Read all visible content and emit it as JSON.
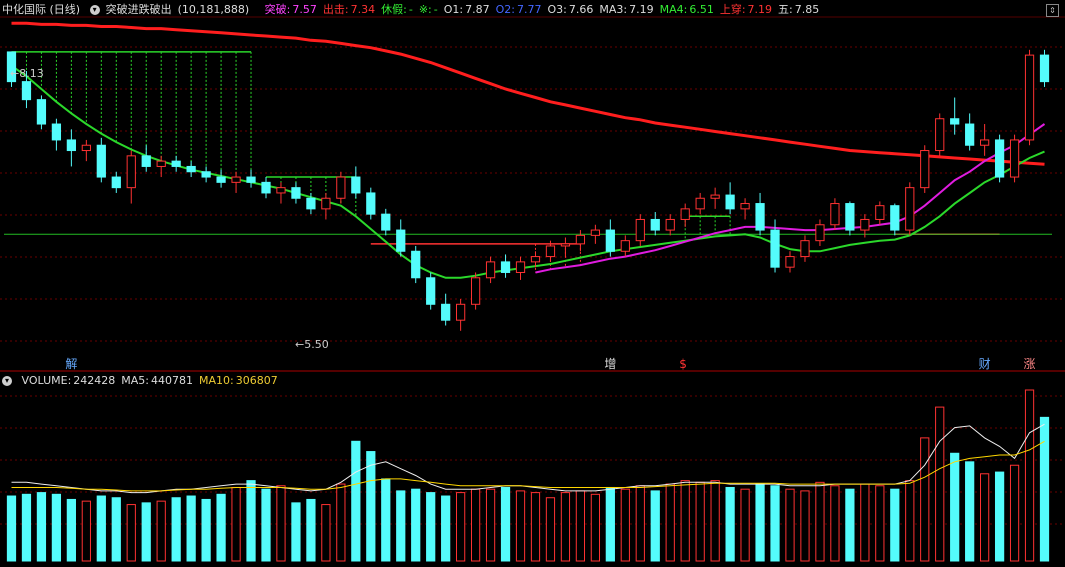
{
  "price_header": {
    "stock": "中化国际 (日线)",
    "indicator_name": "突破进跌破出",
    "params": "(10,181,888)",
    "items": [
      {
        "label": "突破:",
        "value": "7.57",
        "color": "#ff44ff"
      },
      {
        "label": "出击:",
        "value": "7.34",
        "color": "#ff3333"
      },
      {
        "label": "休假:",
        "value": "-",
        "color": "#33ee33"
      },
      {
        "label": "※:",
        "value": "-",
        "color": "#33ee33"
      },
      {
        "label": "O1:",
        "value": "7.87",
        "color": "#dddddd"
      },
      {
        "label": "O2:",
        "value": "7.77",
        "color": "#4466ff"
      },
      {
        "label": "O3:",
        "value": "7.66",
        "color": "#dddddd"
      },
      {
        "label": "MA3:",
        "value": "7.19",
        "color": "#dddddd"
      },
      {
        "label": "MA4:",
        "value": "6.51",
        "color": "#33ee33"
      },
      {
        "label": "上穿:",
        "value": "7.19",
        "color": "#ff3333"
      },
      {
        "label": "五:",
        "value": "7.85",
        "color": "#dddddd"
      }
    ]
  },
  "volume_header": {
    "items": [
      {
        "label": "VOLUME:",
        "value": "242428",
        "color": "#dddddd"
      },
      {
        "label": "MA5:",
        "value": "440781",
        "color": "#dddddd"
      },
      {
        "label": "MA10:",
        "value": "306807",
        "color": "#eecc33"
      }
    ]
  },
  "markers": [
    {
      "text": "解",
      "color": "#66aaff"
    },
    {
      "text": "增",
      "color": "#dddddd"
    },
    {
      "text": "$",
      "color": "#ff3333"
    },
    {
      "text": "财",
      "color": "#66aaff"
    },
    {
      "text": "涨",
      "color": "#ff8888"
    }
  ],
  "annotations": {
    "high": "8.13",
    "low": "5.50"
  },
  "icons": {
    "collapse": "circle-down-icon",
    "scroll": "up-down-icon"
  },
  "colors": {
    "up": "#ff3232",
    "down": "#54fcfc",
    "ma_red": "#ff1e1e",
    "ma_green": "#2bd82b",
    "ma_magenta": "#e01ce0",
    "ma10": "#ffd700"
  },
  "chart_data": [
    {
      "type": "candlestick",
      "ylim": [
        5.3,
        8.45
      ],
      "x_count": 70,
      "ohlc": [
        [
          8.13,
          8.13,
          7.8,
          7.85
        ],
        [
          7.85,
          7.95,
          7.6,
          7.68
        ],
        [
          7.68,
          7.72,
          7.4,
          7.45
        ],
        [
          7.45,
          7.5,
          7.2,
          7.3
        ],
        [
          7.3,
          7.4,
          7.05,
          7.2
        ],
        [
          7.2,
          7.3,
          7.1,
          7.25
        ],
        [
          7.25,
          7.32,
          6.9,
          6.95
        ],
        [
          6.95,
          7.0,
          6.8,
          6.85
        ],
        [
          6.85,
          7.2,
          6.7,
          7.15
        ],
        [
          7.15,
          7.25,
          7.0,
          7.05
        ],
        [
          7.05,
          7.15,
          6.95,
          7.1
        ],
        [
          7.1,
          7.15,
          7.0,
          7.05
        ],
        [
          7.05,
          7.1,
          6.95,
          7.0
        ],
        [
          7.0,
          7.05,
          6.9,
          6.95
        ],
        [
          6.95,
          7.02,
          6.85,
          6.9
        ],
        [
          6.9,
          7.0,
          6.8,
          6.95
        ],
        [
          6.95,
          7.02,
          6.85,
          6.9
        ],
        [
          6.9,
          6.95,
          6.75,
          6.8
        ],
        [
          6.8,
          6.9,
          6.7,
          6.85
        ],
        [
          6.85,
          6.9,
          6.7,
          6.75
        ],
        [
          6.75,
          6.8,
          6.6,
          6.65
        ],
        [
          6.65,
          6.8,
          6.55,
          6.75
        ],
        [
          6.75,
          7.0,
          6.7,
          6.95
        ],
        [
          6.95,
          7.05,
          6.75,
          6.8
        ],
        [
          6.8,
          6.85,
          6.55,
          6.6
        ],
        [
          6.6,
          6.65,
          6.4,
          6.45
        ],
        [
          6.45,
          6.55,
          6.2,
          6.25
        ],
        [
          6.25,
          6.3,
          5.95,
          6.0
        ],
        [
          6.0,
          6.05,
          5.7,
          5.75
        ],
        [
          5.75,
          5.85,
          5.55,
          5.6
        ],
        [
          5.6,
          5.8,
          5.5,
          5.75
        ],
        [
          5.75,
          6.05,
          5.7,
          6.0
        ],
        [
          6.0,
          6.2,
          5.95,
          6.15
        ],
        [
          6.15,
          6.22,
          6.0,
          6.05
        ],
        [
          6.05,
          6.2,
          5.98,
          6.15
        ],
        [
          6.15,
          6.25,
          6.1,
          6.2
        ],
        [
          6.2,
          6.35,
          6.15,
          6.3
        ],
        [
          6.3,
          6.38,
          6.2,
          6.32
        ],
        [
          6.32,
          6.45,
          6.25,
          6.4
        ],
        [
          6.4,
          6.5,
          6.32,
          6.45
        ],
        [
          6.45,
          6.55,
          6.2,
          6.25
        ],
        [
          6.25,
          6.4,
          6.2,
          6.35
        ],
        [
          6.35,
          6.6,
          6.3,
          6.55
        ],
        [
          6.55,
          6.62,
          6.4,
          6.45
        ],
        [
          6.45,
          6.6,
          6.4,
          6.55
        ],
        [
          6.55,
          6.7,
          6.48,
          6.65
        ],
        [
          6.65,
          6.8,
          6.6,
          6.75
        ],
        [
          6.75,
          6.85,
          6.65,
          6.78
        ],
        [
          6.78,
          6.9,
          6.6,
          6.65
        ],
        [
          6.65,
          6.75,
          6.55,
          6.7
        ],
        [
          6.7,
          6.8,
          6.4,
          6.45
        ],
        [
          6.45,
          6.55,
          6.05,
          6.1
        ],
        [
          6.1,
          6.25,
          6.05,
          6.2
        ],
        [
          6.2,
          6.4,
          6.15,
          6.35
        ],
        [
          6.35,
          6.55,
          6.3,
          6.5
        ],
        [
          6.5,
          6.75,
          6.45,
          6.7
        ],
        [
          6.7,
          6.72,
          6.4,
          6.45
        ],
        [
          6.45,
          6.6,
          6.38,
          6.55
        ],
        [
          6.55,
          6.72,
          6.5,
          6.68
        ],
        [
          6.68,
          6.7,
          6.4,
          6.45
        ],
        [
          6.45,
          6.9,
          6.4,
          6.85
        ],
        [
          6.85,
          7.25,
          6.8,
          7.2
        ],
        [
          7.2,
          7.55,
          7.15,
          7.5
        ],
        [
          7.5,
          7.7,
          7.35,
          7.45
        ],
        [
          7.45,
          7.55,
          7.2,
          7.25
        ],
        [
          7.25,
          7.45,
          7.15,
          7.3
        ],
        [
          7.3,
          7.35,
          6.9,
          6.95
        ],
        [
          6.95,
          7.35,
          6.9,
          7.3
        ],
        [
          7.3,
          8.15,
          7.25,
          8.1
        ],
        [
          8.1,
          8.15,
          7.8,
          7.85
        ]
      ],
      "ma_red": [
        8.4,
        8.4,
        8.39,
        8.39,
        8.38,
        8.38,
        8.37,
        8.37,
        8.36,
        8.35,
        8.35,
        8.34,
        8.33,
        8.32,
        8.31,
        8.3,
        8.29,
        8.28,
        8.27,
        8.26,
        8.24,
        8.23,
        8.21,
        8.19,
        8.17,
        8.14,
        8.11,
        8.07,
        8.03,
        7.98,
        7.93,
        7.88,
        7.83,
        7.78,
        7.74,
        7.7,
        7.66,
        7.63,
        7.6,
        7.57,
        7.54,
        7.51,
        7.49,
        7.46,
        7.44,
        7.42,
        7.4,
        7.38,
        7.36,
        7.34,
        7.32,
        7.3,
        7.28,
        7.26,
        7.24,
        7.22,
        7.2,
        7.19,
        7.18,
        7.17,
        7.16,
        7.15,
        7.14,
        7.13,
        7.12,
        7.11,
        7.1,
        7.09,
        7.08,
        7.07
      ],
      "ma_green": [
        8.0,
        7.9,
        7.78,
        7.66,
        7.55,
        7.45,
        7.36,
        7.28,
        7.21,
        7.15,
        7.1,
        7.06,
        7.02,
        6.99,
        6.96,
        6.93,
        6.9,
        6.87,
        6.84,
        6.8,
        6.76,
        6.72,
        6.68,
        6.58,
        6.46,
        6.34,
        6.22,
        6.12,
        6.05,
        6.0,
        6.0,
        6.02,
        6.05,
        6.07,
        6.09,
        6.11,
        6.13,
        6.16,
        6.19,
        6.22,
        6.25,
        6.27,
        6.29,
        6.31,
        6.33,
        6.35,
        6.37,
        6.39,
        6.4,
        6.41,
        6.38,
        6.32,
        6.27,
        6.25,
        6.25,
        6.28,
        6.31,
        6.33,
        6.35,
        6.36,
        6.4,
        6.48,
        6.58,
        6.7,
        6.8,
        6.9,
        6.97,
        7.05,
        7.13,
        7.19
      ],
      "ma_magenta": [
        null,
        null,
        null,
        null,
        null,
        null,
        null,
        null,
        null,
        null,
        null,
        null,
        null,
        null,
        null,
        null,
        null,
        null,
        null,
        null,
        null,
        null,
        null,
        null,
        null,
        null,
        null,
        null,
        null,
        null,
        null,
        null,
        null,
        null,
        null,
        6.05,
        6.08,
        6.1,
        6.12,
        6.15,
        6.18,
        6.2,
        6.23,
        6.26,
        6.3,
        6.34,
        6.38,
        6.42,
        6.45,
        6.48,
        6.48,
        6.47,
        6.46,
        6.45,
        6.45,
        6.46,
        6.47,
        6.48,
        6.5,
        6.52,
        6.58,
        6.68,
        6.8,
        6.92,
        7.0,
        7.1,
        7.18,
        7.25,
        7.35,
        7.45
      ],
      "level_line": 6.41
    },
    {
      "type": "bar",
      "title": "VOLUME",
      "ylim": [
        0,
        1000
      ],
      "values": [
        380,
        390,
        400,
        390,
        360,
        350,
        380,
        370,
        330,
        340,
        350,
        370,
        380,
        360,
        390,
        430,
        470,
        420,
        440,
        340,
        360,
        330,
        450,
        700,
        640,
        480,
        410,
        420,
        400,
        380,
        400,
        420,
        420,
        430,
        410,
        400,
        370,
        400,
        410,
        390,
        430,
        420,
        440,
        410,
        450,
        470,
        460,
        470,
        430,
        420,
        450,
        440,
        420,
        410,
        460,
        440,
        420,
        450,
        440,
        420,
        470,
        720,
        900,
        630,
        580,
        510,
        520,
        560,
        1000,
        840
      ],
      "ma5": [
        460,
        460,
        450,
        440,
        430,
        420,
        410,
        410,
        400,
        400,
        410,
        420,
        420,
        430,
        440,
        450,
        450,
        440,
        430,
        420,
        410,
        420,
        460,
        520,
        560,
        580,
        540,
        500,
        450,
        420,
        420,
        420,
        430,
        440,
        440,
        430,
        420,
        410,
        410,
        410,
        420,
        430,
        440,
        440,
        450,
        460,
        460,
        460,
        450,
        450,
        450,
        450,
        440,
        440,
        440,
        450,
        450,
        450,
        450,
        450,
        470,
        560,
        700,
        780,
        790,
        720,
        670,
        600,
        750,
        800
      ],
      "ma10": [
        430,
        430,
        430,
        430,
        425,
        420,
        420,
        415,
        410,
        410,
        410,
        415,
        420,
        420,
        425,
        430,
        430,
        430,
        430,
        425,
        420,
        420,
        430,
        450,
        470,
        480,
        480,
        470,
        460,
        450,
        440,
        440,
        440,
        440,
        440,
        435,
        430,
        430,
        430,
        430,
        430,
        430,
        430,
        435,
        440,
        445,
        450,
        455,
        455,
        455,
        455,
        455,
        450,
        450,
        450,
        450,
        450,
        450,
        450,
        450,
        455,
        490,
        540,
        580,
        600,
        610,
        620,
        620,
        650,
        700
      ]
    }
  ]
}
